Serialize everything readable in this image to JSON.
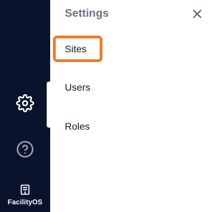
{
  "sidebar": {
    "brand_name": "FacilityOS",
    "items": [
      {
        "icon": "gear-icon"
      },
      {
        "icon": "help-circle-icon"
      }
    ]
  },
  "settings_panel": {
    "title": "Settings",
    "close_icon": "close-icon",
    "menu": [
      {
        "label": "Sites",
        "selected": true
      },
      {
        "label": "Users",
        "selected": false
      },
      {
        "label": "Roles",
        "selected": false
      }
    ]
  },
  "colors": {
    "sidebar_bg": "#09132b",
    "highlight": "#f47a20",
    "title_text": "#6b7280",
    "item_text": "#111827"
  }
}
